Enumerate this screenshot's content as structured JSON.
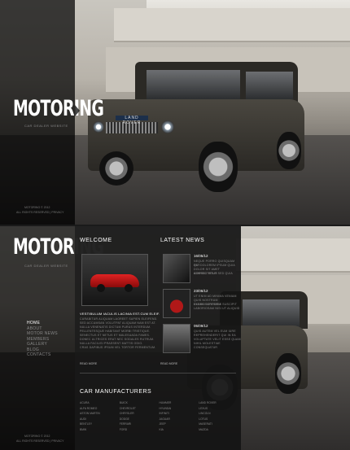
{
  "site": {
    "logo": "MOTORING",
    "tagline": "CAR DEALER WEBSITE"
  },
  "top": {
    "badge": "LAND ROVER",
    "footer_line1": "MOTORING © 2012",
    "footer_line2": "ALL RIGHTS RESERVED | PRIVACY"
  },
  "nav": {
    "items": [
      "HOME",
      "ABOUT",
      "MOTOR NEWS",
      "MEMBERS",
      "GALLERY",
      "BLOG",
      "CONTACTS"
    ]
  },
  "welcome": {
    "heading": "WELCOME",
    "title": "VESTIBULUM IACULIS LACINIA EST.CUM ELEIF.",
    "lines": [
      "CURABITUR ALIQUAM LAOREET SAPIEN ELEIFEND.",
      "SED ACCUMSAN VOLUTPAT ALIQUAM NAM EST AT.",
      "NULLA VENENATIS DICTUM PURUS INTERDUM.",
      "PELLENTESQUE HABITANT MORBI TRISTIQUE.",
      "SENECTUS ET NETUS ET MALESUADA FAMES.",
      "DONEC ULTRICES ERAT NEC SODALES RUTRUM.",
      "NULLA FACILISI PRAESENT MATTIS ODIO.",
      "CRAS DAPIBUS IPSUM VEL TORTOR FERMENTUM."
    ],
    "more": "READ MORE"
  },
  "news": {
    "heading": "LATEST NEWS",
    "items": [
      {
        "date": "16/05/12",
        "lines": [
          "NEQUE PORRO QUISQUAM EST",
          "QUI DOLOREM IPSUM QUIA",
          "DOLOR SIT AMET CONSECTETUR",
          "ADIPISCI VELIT SED QUIA"
        ]
      },
      {
        "date": "23/06/12",
        "lines": [
          "UT ENIM AD MINIMA VENIAM",
          "QUIS NOSTRUM EXERCITATIONEM",
          "ULLAM CORPORIS SUSCIPIT",
          "LABORIOSAM NISI UT ALIQUID"
        ]
      },
      {
        "date": "05/09/12",
        "lines": [
          "QUIS AUTEM VEL EUM IURE",
          "REPREHENDERIT QUI IN EA",
          "VOLUPTATE VELIT ESSE QUAM",
          "NIHIL MOLESTIAE CONSEQUATUR"
        ]
      }
    ],
    "more": "READ MORE"
  },
  "manufacturers": {
    "heading": "CAR MANUFACTURERS",
    "items": [
      "ACURA",
      "BUICK",
      "HUMMER",
      "LAND ROVER",
      "ALFA ROMEO",
      "CHEVROLET",
      "HYUNDAI",
      "LEXUS",
      "ASTON MARTIN",
      "CHRYSLER",
      "INFINITI",
      "LINCOLN",
      "AUDI",
      "DODGE",
      "JAGUAR",
      "LOTUS",
      "BENTLEY",
      "FERRARI",
      "JEEP",
      "MASERATI",
      "BMW",
      "FORD",
      "KIA",
      "MAZDA"
    ]
  },
  "bottom": {
    "footer_line1": "MOTORING © 2012",
    "footer_line2": "ALL RIGHTS RESERVED | PRIVACY"
  }
}
